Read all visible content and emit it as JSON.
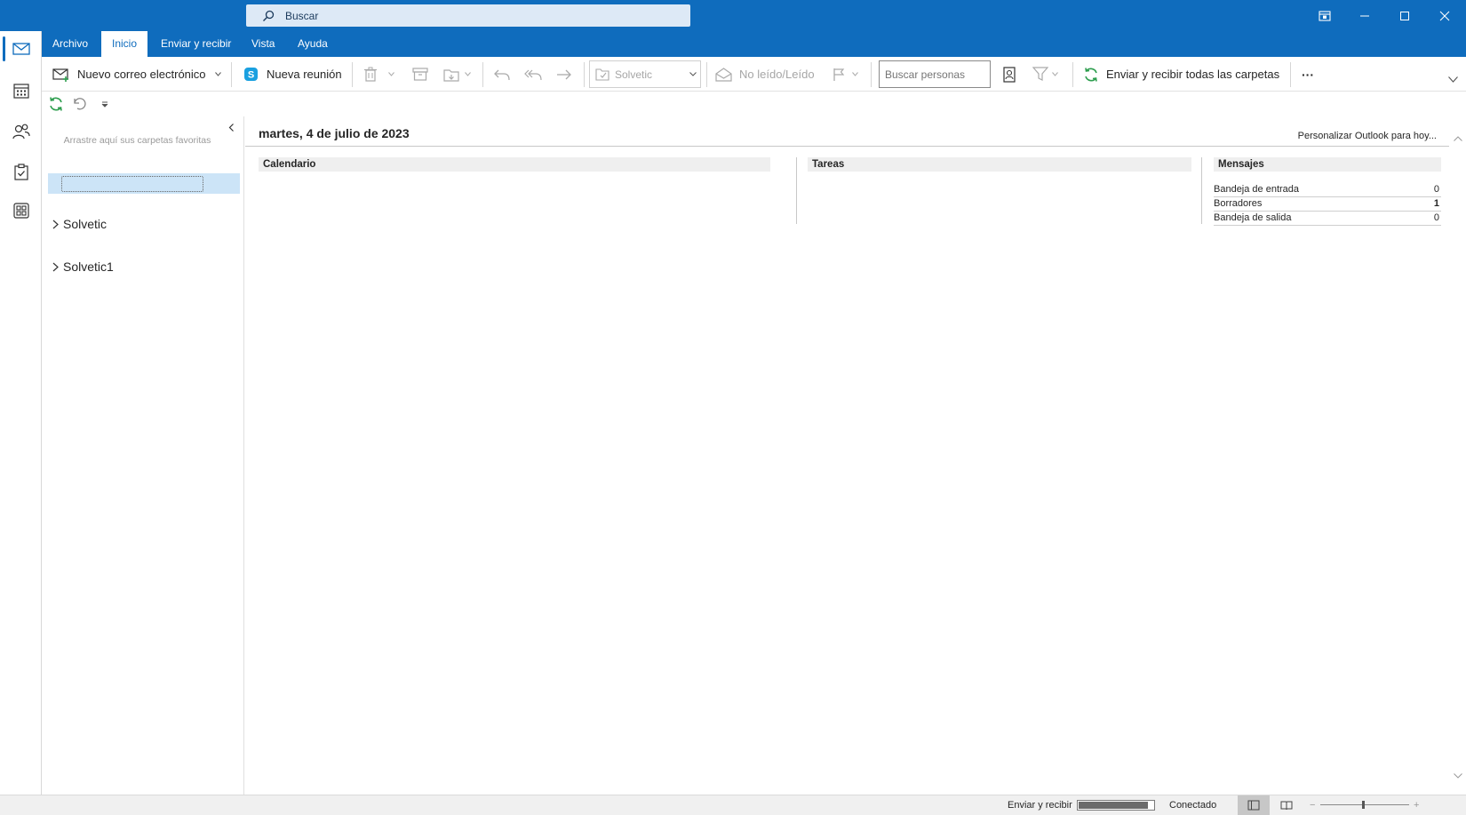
{
  "titlebar": {
    "search_placeholder": "Buscar",
    "icons": [
      "coming-soon-icon",
      "minimize-icon",
      "maximize-icon",
      "close-icon"
    ]
  },
  "tabs": [
    {
      "label": "Archivo",
      "selected": false
    },
    {
      "label": "Inicio",
      "selected": true
    },
    {
      "label": "Enviar y recibir",
      "selected": false
    },
    {
      "label": "Vista",
      "selected": false
    },
    {
      "label": "Ayuda",
      "selected": false
    }
  ],
  "ribbon": {
    "new_email": "Nuevo correo electrónico",
    "new_meeting": "Nueva reunión",
    "folder_dropdown": "Solvetic",
    "unread_read": "No leído/Leído",
    "search_people_placeholder": "Buscar personas",
    "send_receive_all": "Enviar y recibir todas las carpetas",
    "more": "···"
  },
  "folder_pane": {
    "favorites_hint": "Arrastre aquí sus carpetas favoritas",
    "folders": [
      {
        "label": "Solvetic"
      },
      {
        "label": "Solvetic1"
      }
    ]
  },
  "today": {
    "date": "martes, 4 de julio de 2023",
    "customize": "Personalizar Outlook para hoy...",
    "calendar_title": "Calendario",
    "tasks_title": "Tareas",
    "messages_title": "Mensajes",
    "messages": [
      {
        "label": "Bandeja de entrada",
        "count": "0",
        "bold": false
      },
      {
        "label": "Borradores",
        "count": "1",
        "bold": true
      },
      {
        "label": "Bandeja de salida",
        "count": "0",
        "bold": false
      }
    ]
  },
  "statusbar": {
    "send_receive": "Enviar y recibir",
    "progress": 0.93,
    "connection": "Conectado",
    "zoom_minus": "−",
    "zoom_plus": "+"
  },
  "colors": {
    "accent": "#0f6cbd",
    "selection": "#cce4f7",
    "send_receive_icon": "#2e9e4f"
  }
}
